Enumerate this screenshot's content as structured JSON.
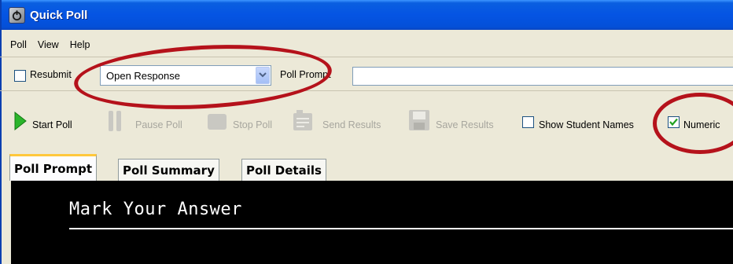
{
  "window": {
    "title": "Quick Poll"
  },
  "menu": {
    "items": [
      "Poll",
      "View",
      "Help"
    ]
  },
  "row1": {
    "resubmit_label": "Resubmit",
    "resubmit_checked": false,
    "poll_type_selected": "Open Response",
    "poll_prompt_label": "Poll Prompt",
    "poll_prompt_value": ""
  },
  "toolbar": {
    "start_poll": "Start Poll",
    "pause_poll": "Pause Poll",
    "stop_poll": "Stop Poll",
    "send_results": "Send Results",
    "save_results": "Save Results",
    "show_student_names": "Show Student Names",
    "show_student_names_checked": false,
    "numeric": "Numeric",
    "numeric_checked": true
  },
  "tabs": [
    "Poll Prompt",
    "Poll Summary",
    "Poll Details"
  ],
  "active_tab": "Poll Prompt",
  "content": {
    "text": "Mark Your Answer"
  },
  "colors": {
    "title_bar": "#0554e3",
    "annotation": "#b5121b",
    "play": "#2bb52b",
    "active_tab_accent": "#ffc83c"
  }
}
